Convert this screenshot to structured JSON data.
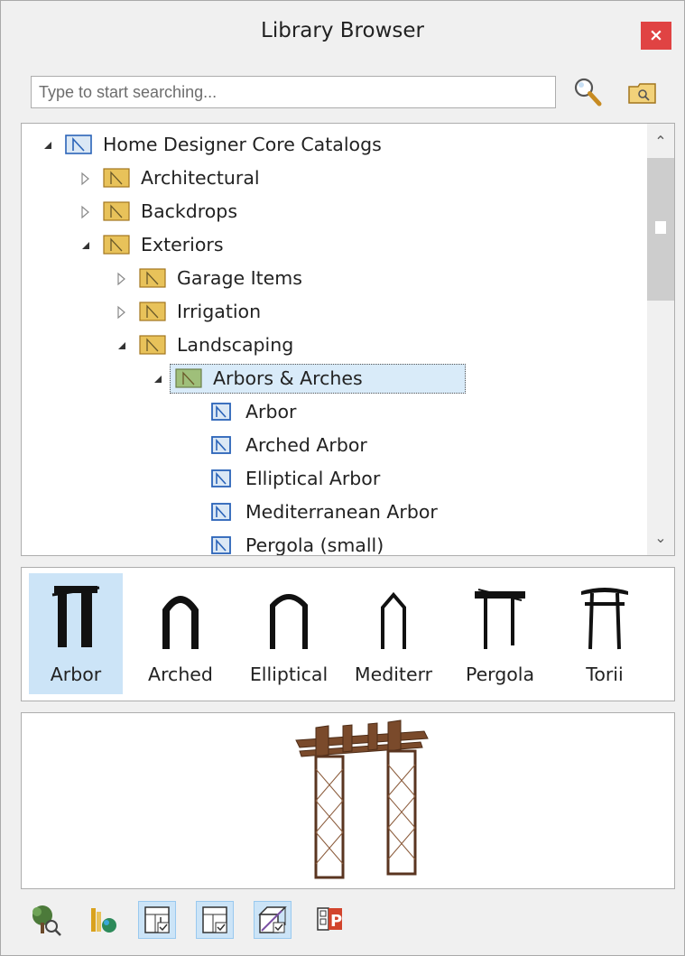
{
  "window": {
    "title": "Library Browser",
    "close_label": "×"
  },
  "search": {
    "placeholder": "Type to start searching..."
  },
  "tree": {
    "items": [
      {
        "label": "Home Designer Core Catalogs",
        "expanded": true,
        "icon": "catalog-icon"
      },
      {
        "label": "Architectural",
        "expanded": false,
        "icon": "folder-icon"
      },
      {
        "label": "Backdrops",
        "expanded": false,
        "icon": "folder-icon"
      },
      {
        "label": "Exteriors",
        "expanded": true,
        "icon": "folder-icon"
      },
      {
        "label": "Garage Items",
        "expanded": false,
        "icon": "folder-icon"
      },
      {
        "label": "Irrigation",
        "expanded": false,
        "icon": "folder-icon"
      },
      {
        "label": "Landscaping",
        "expanded": true,
        "icon": "folder-icon"
      },
      {
        "label": "Arbors & Arches",
        "expanded": true,
        "selected": true,
        "icon": "folder-icon"
      },
      {
        "label": "Arbor",
        "icon": "object-icon"
      },
      {
        "label": "Arched Arbor",
        "icon": "object-icon"
      },
      {
        "label": "Elliptical Arbor",
        "icon": "object-icon"
      },
      {
        "label": "Mediterranean Arbor",
        "icon": "object-icon"
      },
      {
        "label": "Pergola (small)",
        "icon": "object-icon"
      }
    ]
  },
  "thumbnails": [
    {
      "label": "Arbor",
      "selected": true
    },
    {
      "label": "Arched"
    },
    {
      "label": "Elliptical"
    },
    {
      "label": "Mediterr"
    },
    {
      "label": "Pergola"
    },
    {
      "label": "Torii"
    }
  ],
  "toolbar": {
    "buttons": [
      {
        "icon": "plant-chooser-icon"
      },
      {
        "icon": "library-sun-icon"
      },
      {
        "icon": "show-thumbnails-icon",
        "active": true
      },
      {
        "icon": "show-preview-icon",
        "active": true
      },
      {
        "icon": "show-3d-preview-icon",
        "active": true
      },
      {
        "icon": "properties-icon"
      }
    ]
  },
  "colors": {
    "selection": "#cce4f7",
    "folder": "#e8c25a",
    "close": "#e04343",
    "object_icon": "#2a63b8"
  }
}
